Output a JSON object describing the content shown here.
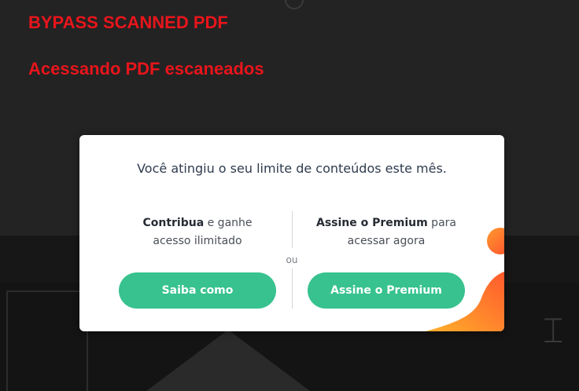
{
  "overlay": {
    "title_en": "BYPASS SCANNED PDF",
    "title_pt": "Acessando PDF escaneados",
    "color": "#e8151b"
  },
  "modal": {
    "heading": "Você atingiu o seu limite de conteúdos este mês.",
    "left": {
      "strong": "Contribua",
      "text1": " e ganhe",
      "text2": "acesso ilimitado",
      "button": "Saiba como"
    },
    "separator": "ou",
    "right": {
      "strong": "Assine o Premium",
      "text1": " para",
      "text2": "acessar agora",
      "button": "Assine o Premium"
    },
    "accent_color": "#37c28f",
    "decoration_colors": [
      "#ffb12b",
      "#ff5a2c"
    ]
  }
}
